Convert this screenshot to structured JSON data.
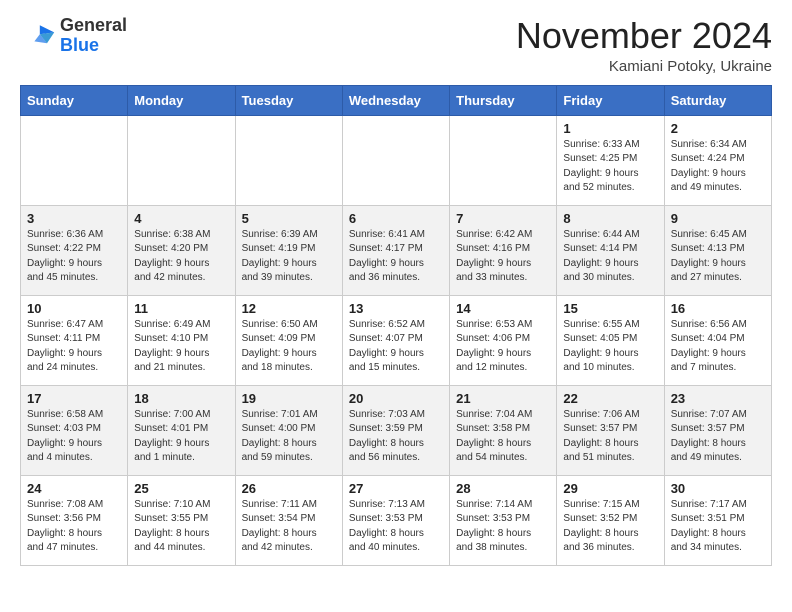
{
  "header": {
    "logo_general": "General",
    "logo_blue": "Blue",
    "month_title": "November 2024",
    "subtitle": "Kamiani Potoky, Ukraine"
  },
  "days_of_week": [
    "Sunday",
    "Monday",
    "Tuesday",
    "Wednesday",
    "Thursday",
    "Friday",
    "Saturday"
  ],
  "weeks": [
    [
      {
        "day": "",
        "info": ""
      },
      {
        "day": "",
        "info": ""
      },
      {
        "day": "",
        "info": ""
      },
      {
        "day": "",
        "info": ""
      },
      {
        "day": "",
        "info": ""
      },
      {
        "day": "1",
        "info": "Sunrise: 6:33 AM\nSunset: 4:25 PM\nDaylight: 9 hours\nand 52 minutes."
      },
      {
        "day": "2",
        "info": "Sunrise: 6:34 AM\nSunset: 4:24 PM\nDaylight: 9 hours\nand 49 minutes."
      }
    ],
    [
      {
        "day": "3",
        "info": "Sunrise: 6:36 AM\nSunset: 4:22 PM\nDaylight: 9 hours\nand 45 minutes."
      },
      {
        "day": "4",
        "info": "Sunrise: 6:38 AM\nSunset: 4:20 PM\nDaylight: 9 hours\nand 42 minutes."
      },
      {
        "day": "5",
        "info": "Sunrise: 6:39 AM\nSunset: 4:19 PM\nDaylight: 9 hours\nand 39 minutes."
      },
      {
        "day": "6",
        "info": "Sunrise: 6:41 AM\nSunset: 4:17 PM\nDaylight: 9 hours\nand 36 minutes."
      },
      {
        "day": "7",
        "info": "Sunrise: 6:42 AM\nSunset: 4:16 PM\nDaylight: 9 hours\nand 33 minutes."
      },
      {
        "day": "8",
        "info": "Sunrise: 6:44 AM\nSunset: 4:14 PM\nDaylight: 9 hours\nand 30 minutes."
      },
      {
        "day": "9",
        "info": "Sunrise: 6:45 AM\nSunset: 4:13 PM\nDaylight: 9 hours\nand 27 minutes."
      }
    ],
    [
      {
        "day": "10",
        "info": "Sunrise: 6:47 AM\nSunset: 4:11 PM\nDaylight: 9 hours\nand 24 minutes."
      },
      {
        "day": "11",
        "info": "Sunrise: 6:49 AM\nSunset: 4:10 PM\nDaylight: 9 hours\nand 21 minutes."
      },
      {
        "day": "12",
        "info": "Sunrise: 6:50 AM\nSunset: 4:09 PM\nDaylight: 9 hours\nand 18 minutes."
      },
      {
        "day": "13",
        "info": "Sunrise: 6:52 AM\nSunset: 4:07 PM\nDaylight: 9 hours\nand 15 minutes."
      },
      {
        "day": "14",
        "info": "Sunrise: 6:53 AM\nSunset: 4:06 PM\nDaylight: 9 hours\nand 12 minutes."
      },
      {
        "day": "15",
        "info": "Sunrise: 6:55 AM\nSunset: 4:05 PM\nDaylight: 9 hours\nand 10 minutes."
      },
      {
        "day": "16",
        "info": "Sunrise: 6:56 AM\nSunset: 4:04 PM\nDaylight: 9 hours\nand 7 minutes."
      }
    ],
    [
      {
        "day": "17",
        "info": "Sunrise: 6:58 AM\nSunset: 4:03 PM\nDaylight: 9 hours\nand 4 minutes."
      },
      {
        "day": "18",
        "info": "Sunrise: 7:00 AM\nSunset: 4:01 PM\nDaylight: 9 hours\nand 1 minute."
      },
      {
        "day": "19",
        "info": "Sunrise: 7:01 AM\nSunset: 4:00 PM\nDaylight: 8 hours\nand 59 minutes."
      },
      {
        "day": "20",
        "info": "Sunrise: 7:03 AM\nSunset: 3:59 PM\nDaylight: 8 hours\nand 56 minutes."
      },
      {
        "day": "21",
        "info": "Sunrise: 7:04 AM\nSunset: 3:58 PM\nDaylight: 8 hours\nand 54 minutes."
      },
      {
        "day": "22",
        "info": "Sunrise: 7:06 AM\nSunset: 3:57 PM\nDaylight: 8 hours\nand 51 minutes."
      },
      {
        "day": "23",
        "info": "Sunrise: 7:07 AM\nSunset: 3:57 PM\nDaylight: 8 hours\nand 49 minutes."
      }
    ],
    [
      {
        "day": "24",
        "info": "Sunrise: 7:08 AM\nSunset: 3:56 PM\nDaylight: 8 hours\nand 47 minutes."
      },
      {
        "day": "25",
        "info": "Sunrise: 7:10 AM\nSunset: 3:55 PM\nDaylight: 8 hours\nand 44 minutes."
      },
      {
        "day": "26",
        "info": "Sunrise: 7:11 AM\nSunset: 3:54 PM\nDaylight: 8 hours\nand 42 minutes."
      },
      {
        "day": "27",
        "info": "Sunrise: 7:13 AM\nSunset: 3:53 PM\nDaylight: 8 hours\nand 40 minutes."
      },
      {
        "day": "28",
        "info": "Sunrise: 7:14 AM\nSunset: 3:53 PM\nDaylight: 8 hours\nand 38 minutes."
      },
      {
        "day": "29",
        "info": "Sunrise: 7:15 AM\nSunset: 3:52 PM\nDaylight: 8 hours\nand 36 minutes."
      },
      {
        "day": "30",
        "info": "Sunrise: 7:17 AM\nSunset: 3:51 PM\nDaylight: 8 hours\nand 34 minutes."
      }
    ]
  ]
}
